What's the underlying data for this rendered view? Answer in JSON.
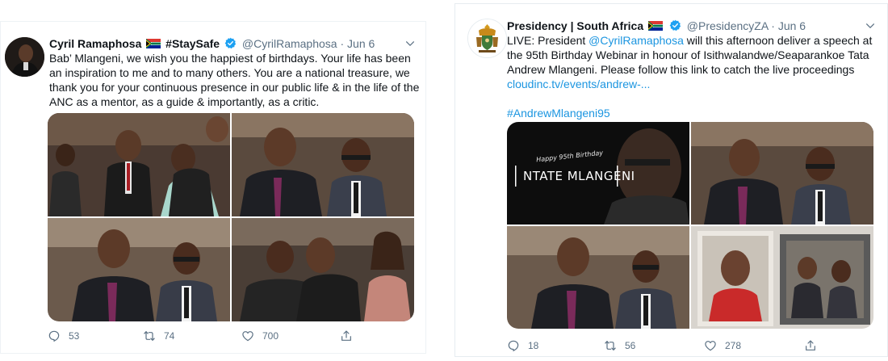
{
  "tweets": [
    {
      "author_name": "Cyril Ramaphosa",
      "author_suffix": "#StaySafe",
      "handle": "@CyrilRamaphosa",
      "date": "Jun 6",
      "body": "Bab’ Mlangeni, we wish you the happiest of birthdays. Your life has been an inspiration to me and to many others. You are a national treasure, we thank you for your continuous presence in our public life & in the life of the ANC as a mentor, as a guide & importantly, as a critic.",
      "replies": "53",
      "retweets": "74",
      "likes": "700"
    },
    {
      "author_name": "Presidency | South Africa",
      "handle": "@PresidencyZA",
      "date": "Jun 6",
      "body_prefix": "LIVE: President ",
      "body_mention": "@CyrilRamaphosa",
      "body_rest": " will this afternoon deliver a speech at the 95th Birthday Webinar in honour of Isithwalandwe/Seaparankoe Tata Andrew Mlangeni. Please follow this link to catch the live proceedings ",
      "body_link": "cloudinc.tv/events/andrew-...",
      "hashtag": "#AndrewMlangeni95",
      "banner_small": "Happy 95th Birthday",
      "banner_big": "NTATE MLANGENI",
      "replies": "18",
      "retweets": "56",
      "likes": "278"
    }
  ],
  "separator": "·",
  "colors": {
    "link_blue": "#1b95e0",
    "verified_blue": "#1da1f2",
    "muted_gray": "#5b7083",
    "border": "#e6ecf0"
  },
  "icons": [
    "reply-icon",
    "retweet-icon",
    "like-icon",
    "share-icon",
    "chevron-down-icon",
    "verified-badge-icon",
    "south-africa-flag-icon",
    "coat-of-arms-icon"
  ]
}
